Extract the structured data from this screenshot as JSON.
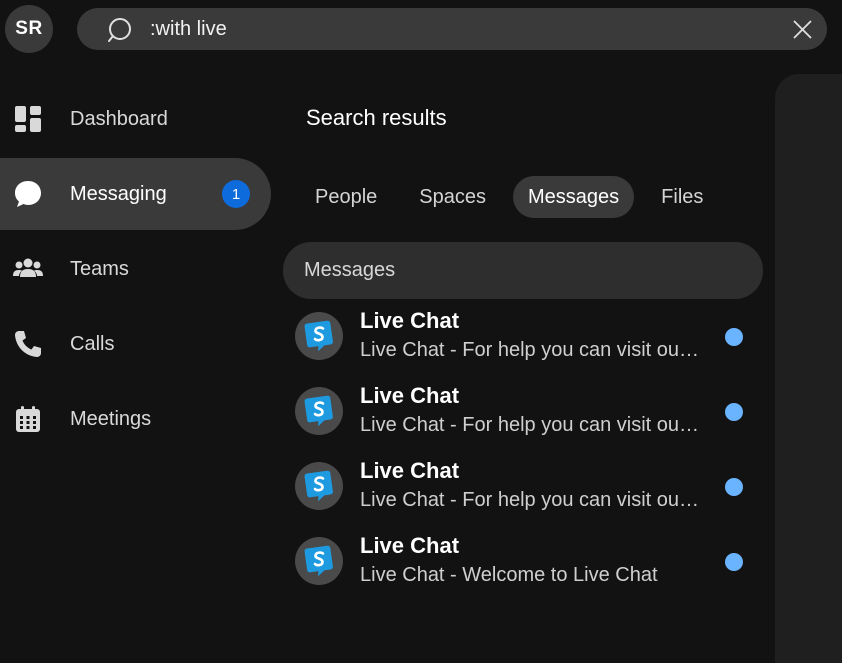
{
  "user": {
    "initials": "SR"
  },
  "search": {
    "value": ":with live",
    "placeholder": ""
  },
  "sidebar": {
    "items": [
      {
        "label": "Dashboard",
        "icon": "dashboard-icon"
      },
      {
        "label": "Messaging",
        "icon": "chat-bubble-icon",
        "badge": "1",
        "active": true
      },
      {
        "label": "Teams",
        "icon": "teams-icon"
      },
      {
        "label": "Calls",
        "icon": "phone-icon"
      },
      {
        "label": "Meetings",
        "icon": "calendar-icon"
      }
    ]
  },
  "main": {
    "title": "Search results",
    "tabs": [
      {
        "label": "People"
      },
      {
        "label": "Spaces"
      },
      {
        "label": "Messages",
        "active": true
      },
      {
        "label": "Files"
      }
    ],
    "section_header": "Messages",
    "messages": [
      {
        "title": "Live Chat",
        "preview": "Live Chat - For help you can visit our website",
        "unread": true
      },
      {
        "title": "Live Chat",
        "preview": "Live Chat - For help you can visit our website",
        "unread": true
      },
      {
        "title": "Live Chat",
        "preview": "Live Chat - For help you can visit our website",
        "unread": true
      },
      {
        "title": "Live Chat",
        "preview": "Live Chat - Welcome to Live Chat",
        "unread": true
      }
    ]
  },
  "colors": {
    "background": "#121212",
    "surface": "#3a3a3a",
    "badge": "#0d6bdc",
    "unread_dot": "#6ab4ff",
    "bot_avatar": "#1e9be0"
  }
}
